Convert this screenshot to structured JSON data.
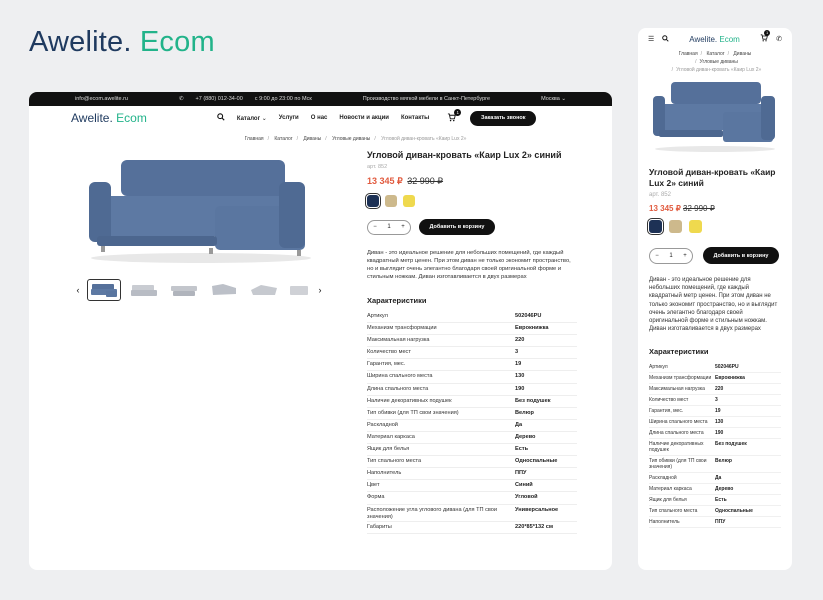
{
  "brand": {
    "part1": "Awelite.",
    "part2": "Ecom"
  },
  "colors": {
    "accent": "#22b38a",
    "navy": "#1f3a5f",
    "price": "#e15b3f"
  },
  "topbar": {
    "email": "info@ecom.awelite.ru",
    "phone": "+7 (880) 012-34-00",
    "hours": "с 9:00 до 23:00 по Мск",
    "tagline": "Производство мягкой мебели в Санкт-Петербурге",
    "city": "Москва"
  },
  "nav": {
    "items": [
      "Каталог",
      "Услуги",
      "О нас",
      "Новости и акции",
      "Контакты"
    ],
    "cart_count": "1",
    "call_button": "Заказать звонок"
  },
  "breadcrumbs": {
    "items": [
      "Главная",
      "Каталог",
      "Диваны",
      "Угловые диваны"
    ],
    "current": "Угловой диван-кровать «Каир Lux 2»"
  },
  "product": {
    "title": "Угловой диван-кровать «Каир Lux 2» синий",
    "sku": "арт. 852",
    "price": "13 345 ₽",
    "old_price": "32 990 ₽",
    "swatch_colors": [
      "#1d3155",
      "#cdb98c",
      "#efd94e"
    ],
    "quantity": "1",
    "qty_minus": "−",
    "qty_plus": "+",
    "add_to_cart": "Добавить в корзину",
    "description": "Диван - это идеальное решение для небольших помещений, где каждый квадратный метр ценен. При этом диван не только экономит пространство, но и выглядит очень элегантно благодаря своей оригинальной форме и стильным ножкам. Диван изготавливается в двух размерах",
    "characteristics_title": "Характеристики",
    "characteristics": [
      {
        "k": "Артикул",
        "v": "502046PU"
      },
      {
        "k": "Механизм трансформации",
        "v": "Еврокнижка"
      },
      {
        "k": "Максимальная нагрузка",
        "v": "220"
      },
      {
        "k": "Количество мест",
        "v": "3"
      },
      {
        "k": "Гарантия, мес.",
        "v": "19"
      },
      {
        "k": "Ширина спального места",
        "v": "130"
      },
      {
        "k": "Длина спального места",
        "v": "190"
      },
      {
        "k": "Наличие декоративных подушек",
        "v": "Без подушек"
      },
      {
        "k": "Тип обивки (для ТП свои значения)",
        "v": "Велюр"
      },
      {
        "k": "Раскладной",
        "v": "Да"
      },
      {
        "k": "Материал каркаса",
        "v": "Дерево"
      },
      {
        "k": "Ящик для белья",
        "v": "Есть"
      },
      {
        "k": "Тип спального места",
        "v": "Односпальные"
      },
      {
        "k": "Наполнитель",
        "v": "ППУ"
      },
      {
        "k": "Цвет",
        "v": "Синий"
      },
      {
        "k": "Форма",
        "v": "Угловой"
      },
      {
        "k": "Расположение угла углового дивана (для ТП свои значения)",
        "v": "Универсальное"
      },
      {
        "k": "Габариты",
        "v": "220*85*132 см"
      }
    ]
  },
  "mobile": {
    "brand_part1": "Awelite.",
    "brand_part2": "Ecom",
    "cart_count": "1",
    "title": "Угловой диван-кровать «Каир Lux 2» синий",
    "sku": "арт. 852",
    "price": "13 345 ₽",
    "old_price": "32 990 ₽",
    "quantity": "1",
    "add_to_cart": "Добавить в корзину",
    "description": "Диван - это идеальное решение для небольших помещений, где каждый квадратный метр ценен. При этом диван не только экономит пространство, но и выглядит очень элегантно благодаря своей оригинальной форме и стильным ножкам. Диван изготавливается в двух размерах",
    "characteristics_title": "Характеристики",
    "characteristics": [
      {
        "k": "Артикул",
        "v": "502046PU"
      },
      {
        "k": "Механизм трансформации",
        "v": "Еврокнижка"
      },
      {
        "k": "Максимальная нагрузка",
        "v": "220"
      },
      {
        "k": "Количество мест",
        "v": "3"
      },
      {
        "k": "Гарантия, мес.",
        "v": "19"
      },
      {
        "k": "Ширина спального места",
        "v": "130"
      },
      {
        "k": "Длина спального места",
        "v": "190"
      },
      {
        "k": "Наличие декоративных подушек",
        "v": "Без подушек"
      },
      {
        "k": "Тип обивки (для ТП свои значения)",
        "v": "Велюр"
      },
      {
        "k": "Раскладной",
        "v": "Да"
      },
      {
        "k": "Материал каркаса",
        "v": "Дерево"
      },
      {
        "k": "Ящик для белья",
        "v": "Есть"
      },
      {
        "k": "Тип спального места",
        "v": "Односпальные"
      },
      {
        "k": "Наполнитель",
        "v": "ППУ"
      }
    ]
  }
}
